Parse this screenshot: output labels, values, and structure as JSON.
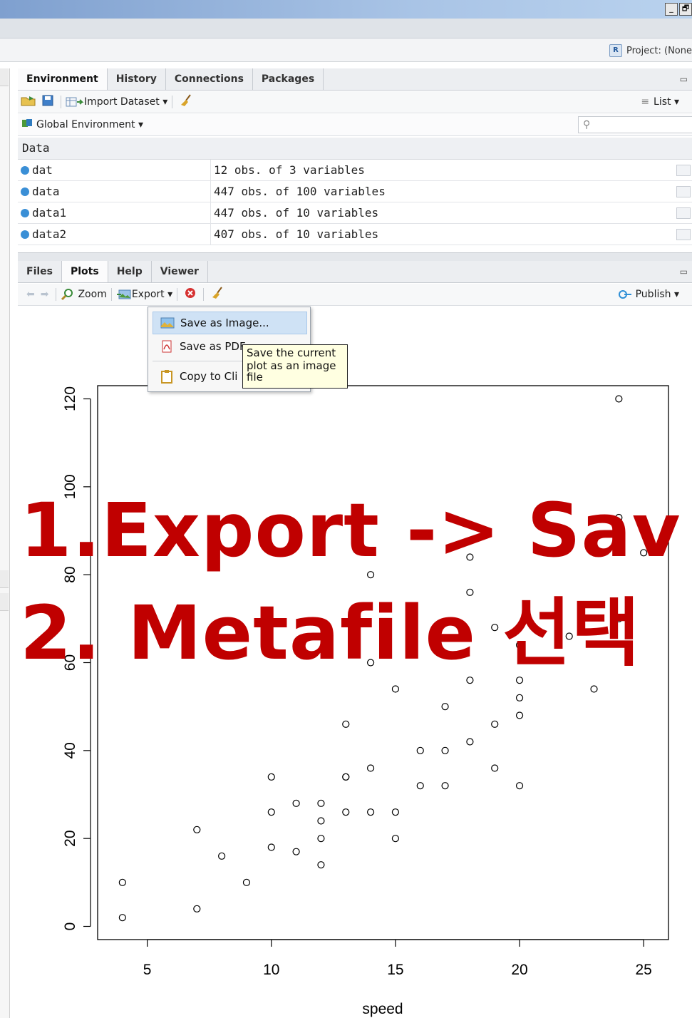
{
  "window": {
    "buttons": [
      "_",
      "🗗"
    ]
  },
  "project": {
    "label": "Project: (None",
    "logo": "R"
  },
  "env_pane": {
    "tabs": [
      "Environment",
      "History",
      "Connections",
      "Packages"
    ],
    "active_tab": "Environment",
    "toolbar": {
      "import_label": "Import Dataset ▾",
      "view_label": "List ▾"
    },
    "scope_label": "Global Environment ▾",
    "search_placeholder": "",
    "section": "Data",
    "rows": [
      {
        "name": "dat",
        "value": "12 obs. of 3 variables"
      },
      {
        "name": "data",
        "value": "447 obs. of 100 variables"
      },
      {
        "name": "data1",
        "value": "447 obs. of 10 variables"
      },
      {
        "name": "data2",
        "value": "407 obs. of 10 variables"
      }
    ]
  },
  "plots_pane": {
    "tabs": [
      "Files",
      "Plots",
      "Help",
      "Viewer"
    ],
    "active_tab": "Plots",
    "toolbar": {
      "zoom_label": "Zoom",
      "export_label": "Export ▾",
      "publish_label": "Publish ▾"
    }
  },
  "export_menu": {
    "items": [
      "Save as Image...",
      "Save as PDF",
      "Copy to Cli"
    ]
  },
  "tooltip": {
    "lines": [
      "Save the current",
      "plot as an image",
      "file"
    ]
  },
  "overlay": {
    "line1": "1.Export -> Sav",
    "line2": "2. Metafile 선택"
  },
  "chart_data": {
    "type": "scatter",
    "title": "",
    "xlabel": "speed",
    "ylabel": "",
    "xlim": [
      3,
      26
    ],
    "ylim": [
      -3,
      123
    ],
    "xticks": [
      5,
      10,
      15,
      20,
      25
    ],
    "yticks": [
      0,
      20,
      40,
      60,
      80,
      100,
      120
    ],
    "grid": false,
    "x": [
      4,
      4,
      7,
      7,
      8,
      9,
      10,
      10,
      10,
      11,
      11,
      12,
      12,
      12,
      12,
      13,
      13,
      13,
      13,
      14,
      14,
      14,
      14,
      15,
      15,
      15,
      16,
      16,
      17,
      17,
      17,
      18,
      18,
      18,
      18,
      19,
      19,
      19,
      20,
      20,
      20,
      20,
      20,
      22,
      23,
      24,
      24,
      24,
      24,
      25
    ],
    "y": [
      2,
      10,
      4,
      22,
      16,
      10,
      18,
      26,
      34,
      17,
      28,
      14,
      20,
      24,
      28,
      26,
      34,
      34,
      46,
      26,
      36,
      60,
      80,
      20,
      26,
      54,
      32,
      40,
      32,
      40,
      50,
      42,
      56,
      76,
      84,
      36,
      46,
      68,
      32,
      48,
      52,
      56,
      64,
      66,
      54,
      70,
      92,
      93,
      120,
      85
    ]
  }
}
